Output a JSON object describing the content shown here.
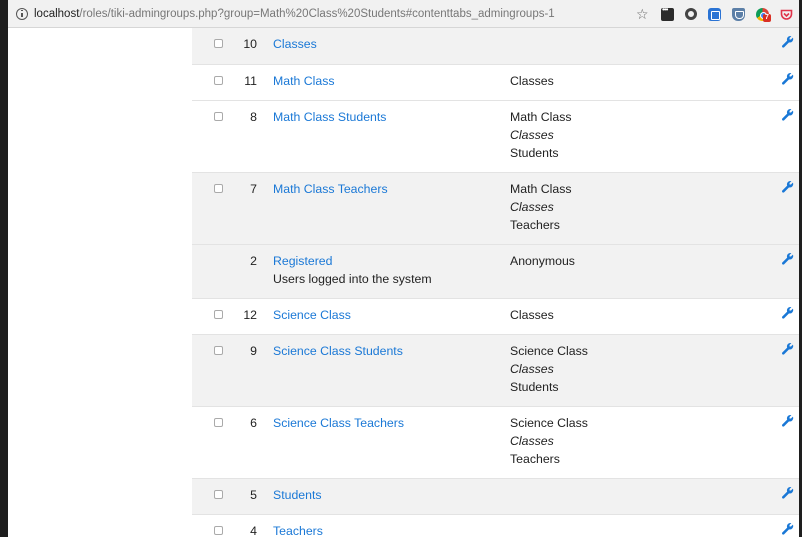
{
  "browser": {
    "url_host": "localhost",
    "url_rest": "/roles/tiki-admingroups.php?group=Math%20Class%20Students#contenttabs_admingroups-1",
    "extension_badge": "7",
    "icons": [
      "info-icon",
      "star-icon",
      "extension-dark-icon",
      "extension-circle-icon",
      "extension-blue-icon",
      "extension-shield-icon",
      "chrome-extension-icon",
      "pocket-icon"
    ]
  },
  "colors": {
    "link": "#1a78d6",
    "row_shaded": "#f2f2f2",
    "wrench": "#1a78d6"
  },
  "groups": [
    {
      "id": "10",
      "name": "Classes",
      "desc": "",
      "parents": [],
      "shaded": true,
      "checkbox": true
    },
    {
      "id": "11",
      "name": "Math Class",
      "desc": "",
      "parents": [
        {
          "text": "Classes",
          "italic": false
        }
      ],
      "shaded": false,
      "checkbox": true
    },
    {
      "id": "8",
      "name": "Math Class Students",
      "desc": "",
      "parents": [
        {
          "text": "Math Class",
          "italic": false
        },
        {
          "text": "Classes",
          "italic": true
        },
        {
          "text": "Students",
          "italic": false
        }
      ],
      "shaded": false,
      "checkbox": true
    },
    {
      "id": "7",
      "name": "Math Class Teachers",
      "desc": "",
      "parents": [
        {
          "text": "Math Class",
          "italic": false
        },
        {
          "text": "Classes",
          "italic": true
        },
        {
          "text": "Teachers",
          "italic": false
        }
      ],
      "shaded": true,
      "checkbox": true
    },
    {
      "id": "2",
      "name": "Registered",
      "desc": "Users logged into the system",
      "parents": [
        {
          "text": "Anonymous",
          "italic": false
        }
      ],
      "shaded": true,
      "checkbox": false
    },
    {
      "id": "12",
      "name": "Science Class",
      "desc": "",
      "parents": [
        {
          "text": "Classes",
          "italic": false
        }
      ],
      "shaded": false,
      "checkbox": true
    },
    {
      "id": "9",
      "name": "Science Class Students",
      "desc": "",
      "parents": [
        {
          "text": "Science Class",
          "italic": false
        },
        {
          "text": "Classes",
          "italic": true
        },
        {
          "text": "Students",
          "italic": false
        }
      ],
      "shaded": true,
      "checkbox": true
    },
    {
      "id": "6",
      "name": "Science Class Teachers",
      "desc": "",
      "parents": [
        {
          "text": "Science Class",
          "italic": false
        },
        {
          "text": "Classes",
          "italic": true
        },
        {
          "text": "Teachers",
          "italic": false
        }
      ],
      "shaded": false,
      "checkbox": true
    },
    {
      "id": "5",
      "name": "Students",
      "desc": "",
      "parents": [],
      "shaded": true,
      "checkbox": true
    },
    {
      "id": "4",
      "name": "Teachers",
      "desc": "",
      "parents": [],
      "shaded": false,
      "checkbox": true
    }
  ]
}
